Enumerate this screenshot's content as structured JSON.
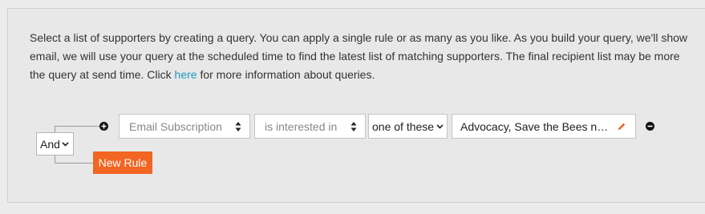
{
  "intro": {
    "line1": "Select a list of supporters by creating a query. You can apply a single rule or as many as you like. As you build your query, we'll show",
    "line2": "email, we will use your query at the scheduled time to find the latest list of matching supporters. The final recipient list may be more",
    "line3_before": "the query at send time. Click ",
    "link_text": "here",
    "line3_after": " for more information about queries."
  },
  "query": {
    "logic_operator": "And",
    "new_rule_label": "New Rule",
    "rule": {
      "field": "Email Subscription",
      "condition": "is interested in",
      "match": "one of these",
      "values": "Advocacy, Save the Bees ne..."
    }
  },
  "icons": {
    "add": "plus-circle-icon",
    "remove": "minus-circle-icon",
    "edit": "pencil-icon",
    "select_arrows": "up-down-arrows-icon",
    "dropdown": "chevron-down-icon"
  },
  "colors": {
    "accent": "#f26522",
    "link": "#1a9bbd"
  }
}
